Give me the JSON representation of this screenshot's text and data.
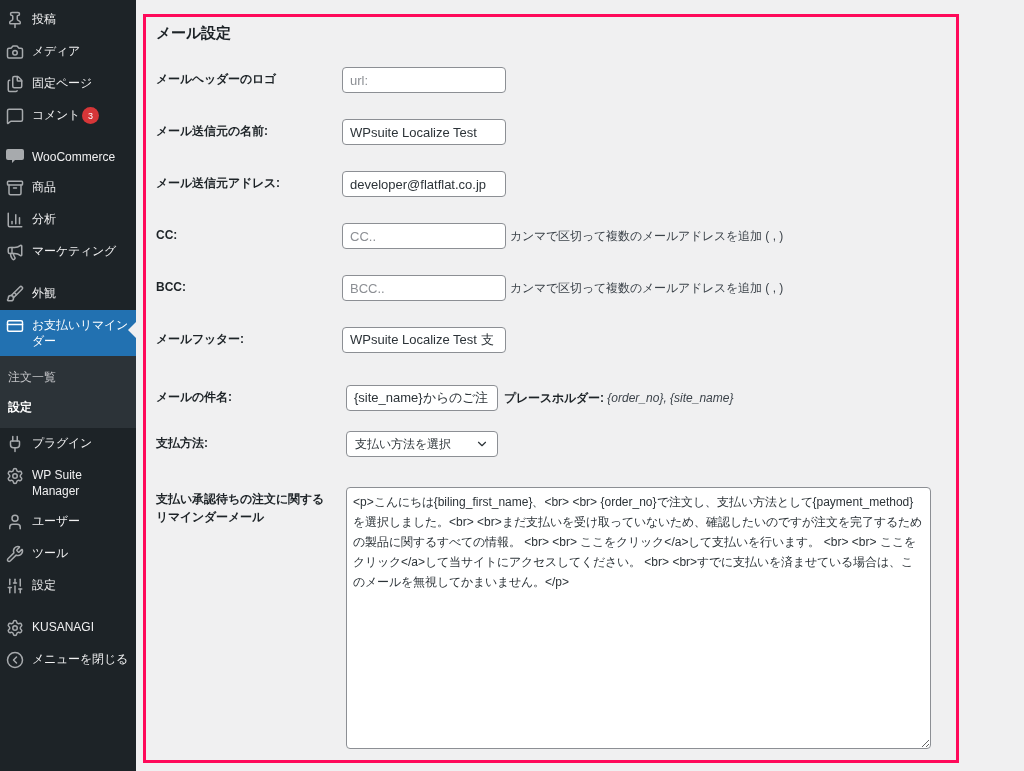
{
  "sidebar": {
    "groups": [
      [
        {
          "label": "投稿",
          "selected": false
        },
        {
          "label": "メディア",
          "selected": false
        },
        {
          "label": "固定ページ",
          "selected": false
        },
        {
          "label": "コメント",
          "badge": "3",
          "selected": false
        }
      ],
      [
        {
          "label": "WooCommerce",
          "selected": false
        },
        {
          "label": "商品",
          "selected": false
        },
        {
          "label": "分析",
          "selected": false
        },
        {
          "label": "マーケティング",
          "selected": false
        }
      ],
      [
        {
          "label": "外観",
          "selected": false
        },
        {
          "label": "お支払いリマインダー",
          "selected": true,
          "children": [
            {
              "label": "注文一覧",
              "selected": false
            },
            {
              "label": "設定",
              "selected": true
            }
          ]
        },
        {
          "label": "プラグイン",
          "selected": false
        },
        {
          "label": "WP Suite Manager",
          "selected": false
        },
        {
          "label": "ユーザー",
          "selected": false
        },
        {
          "label": "ツール",
          "selected": false
        },
        {
          "label": "設定",
          "selected": false
        }
      ],
      [
        {
          "label": "KUSANAGI",
          "selected": false
        },
        {
          "label": "メニューを閉じる",
          "selected": false
        }
      ]
    ]
  },
  "section": {
    "title": "メール設定",
    "fields": [
      {
        "kind": "text",
        "label": "メールヘッダーのロゴ",
        "placeholder": "url:"
      },
      {
        "kind": "text",
        "label": "メール送信元の名前:",
        "value": "WPsuite Localize Test"
      },
      {
        "kind": "text",
        "label": "メール送信元アドレス:",
        "value": "developer@flatflat.co.jp"
      },
      {
        "kind": "text",
        "label": "CC:",
        "placeholder": "CC..",
        "hint": "カンマで区切って複数のメールアドレスを追加 ( , )"
      },
      {
        "kind": "text",
        "label": "BCC:",
        "placeholder": "BCC..",
        "hint": "カンマで区切って複数のメールアドレスを追加 ( , )"
      },
      {
        "kind": "text",
        "label": "メールフッター:",
        "value": "WPsuite Localize Test 支"
      },
      {
        "kind": "subject",
        "label": "メールの件名:",
        "value": "{site_name}からのご注",
        "note_label": "プレースホルダー:",
        "note_value": "{order_no}, {site_name}"
      },
      {
        "kind": "select",
        "label": "支払方法:",
        "value": "支払い方法を選択"
      },
      {
        "kind": "textarea",
        "label": "支払い承認待ちの注文に関するリマインダーメール",
        "value": "<p>こんにちは{biling_first_name}、<br> <br> {order_no}で注文し、支払い方法として{payment_method}を選択しました。<br> <br>まだ支払いを受け取っていないため、確認したいのですが注文を完了するための製品に関するすべての情報。 <br> <br> ここをクリック</a>して支払いを行います。 <br> <br> ここをクリック</a>して当サイトにアクセスしてください。 <br> <br>すでに支払いを済ませている場合は、このメールを無視してかまいません。</p>"
      }
    ]
  }
}
